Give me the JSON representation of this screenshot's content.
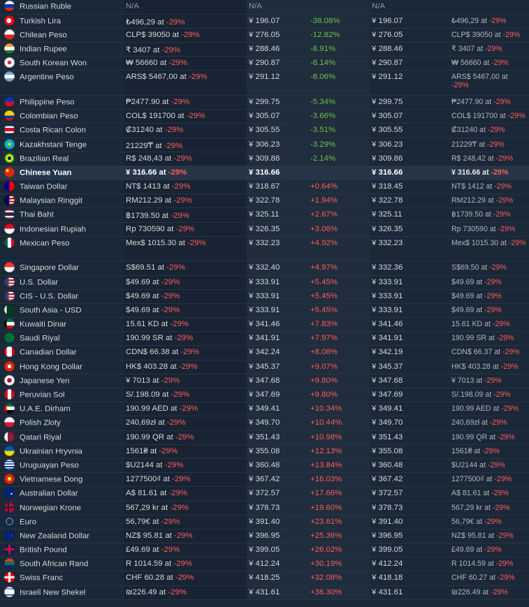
{
  "columns": [
    "country_currency",
    "local_price",
    "converted_price",
    "percent_diff",
    "converted_price_alt",
    "local_price_alt"
  ],
  "rows": [
    {
      "name": "Russian Ruble",
      "flag": "russia-flag",
      "local": "N/A",
      "conv": "N/A",
      "pct": "",
      "conv2": "N/A",
      "orig": ""
    },
    {
      "name": "Turkish Lira",
      "flag": "turkey-flag",
      "local": "₺496,29 at ",
      "disc": "-29%",
      "conv": "¥ 196.07",
      "pct": "-38.08%",
      "conv2": "¥ 196.07",
      "orig": "₺496,29 at ",
      "odisc": "-29%"
    },
    {
      "name": "Chilean Peso",
      "flag": "chile-flag",
      "local": "CLP$ 39050 at ",
      "disc": "-29%",
      "conv": "¥ 276.05",
      "pct": "-12.82%",
      "conv2": "¥ 276.05",
      "orig": "CLP$ 39050 at ",
      "odisc": "-29%"
    },
    {
      "name": "Indian Rupee",
      "flag": "india-flag",
      "local": "₹ 3407 at ",
      "disc": "-29%",
      "conv": "¥ 288.46",
      "pct": "-8.91%",
      "conv2": "¥ 288.46",
      "orig": "₹ 3407 at ",
      "odisc": "-29%"
    },
    {
      "name": "South Korean Won",
      "flag": "korea-flag",
      "local": "₩ 56660 at ",
      "disc": "-29%",
      "conv": "¥ 290.87",
      "pct": "-8.14%",
      "conv2": "¥ 290.87",
      "orig": "₩ 56660 at ",
      "odisc": "-29%"
    },
    {
      "name": "Argentine Peso",
      "flag": "argentina-flag",
      "local": "ARS$ 5467,00 at ",
      "disc": "-29%",
      "conv": "¥ 291.12",
      "pct": "-8.06%",
      "conv2": "¥ 291.12",
      "orig": "ARS$ 5467,00 at ",
      "odisc": "-29%",
      "tall": true
    },
    {
      "name": "Philippine Peso",
      "flag": "philippines-flag",
      "local": "₱2477.90 at ",
      "disc": "-29%",
      "conv": "¥ 299.75",
      "pct": "-5.34%",
      "conv2": "¥ 299.75",
      "orig": "₱2477.90 at ",
      "odisc": "-29%"
    },
    {
      "name": "Colombian Peso",
      "flag": "colombia-flag",
      "local": "COL$ 191700 at ",
      "disc": "-29%",
      "conv": "¥ 305.07",
      "pct": "-3.66%",
      "conv2": "¥ 305.07",
      "orig": "COL$ 191700 at ",
      "odisc": "-29%"
    },
    {
      "name": "Costa Rican Colon",
      "flag": "costa-rica-flag",
      "local": "₡31240 at ",
      "disc": "-29%",
      "conv": "¥ 305.55",
      "pct": "-3.51%",
      "conv2": "¥ 305.55",
      "orig": "₡31240 at ",
      "odisc": "-29%"
    },
    {
      "name": "Kazakhstani Tenge",
      "flag": "kazakhstan-flag",
      "local": "21229₸ at ",
      "disc": "-29%",
      "conv": "¥ 306.23",
      "pct": "-3.29%",
      "conv2": "¥ 306.23",
      "orig": "21229₸ at ",
      "odisc": "-29%"
    },
    {
      "name": "Brazilian Real",
      "flag": "brazil-flag",
      "local": "R$ 248,43 at ",
      "disc": "-29%",
      "conv": "¥ 309.88",
      "pct": "-2.14%",
      "conv2": "¥ 309.86",
      "orig": "R$ 248,42 at ",
      "odisc": "-29%"
    },
    {
      "name": "Chinese Yuan",
      "flag": "china-flag",
      "local": "¥ 316.66 at ",
      "disc": "-29%",
      "conv": "¥ 316.66",
      "pct": "",
      "conv2": "¥ 316.66",
      "orig": "¥ 316.66 at ",
      "odisc": "-29%",
      "highlight": true
    },
    {
      "name": "Taiwan Dollar",
      "flag": "taiwan-flag",
      "local": "NT$ 1413 at ",
      "disc": "-29%",
      "conv": "¥ 318.67",
      "pct": "+0.64%",
      "conv2": "¥ 318.45",
      "orig": "NT$ 1412 at ",
      "odisc": "-29%"
    },
    {
      "name": "Malaysian Ringgit",
      "flag": "malaysia-flag",
      "local": "RM212.29 at ",
      "disc": "-29%",
      "conv": "¥ 322.78",
      "pct": "+1.94%",
      "conv2": "¥ 322.78",
      "orig": "RM212.29 at ",
      "odisc": "-29%"
    },
    {
      "name": "Thai Baht",
      "flag": "thailand-flag",
      "local": "฿1739.50 at ",
      "disc": "-29%",
      "conv": "¥ 325.11",
      "pct": "+2.67%",
      "conv2": "¥ 325.11",
      "orig": "฿1739.50 at ",
      "odisc": "-29%"
    },
    {
      "name": "Indonesian Rupiah",
      "flag": "indonesia-flag",
      "local": "Rp 730590 at ",
      "disc": "-29%",
      "conv": "¥ 326.35",
      "pct": "+3.06%",
      "conv2": "¥ 326.35",
      "orig": "Rp 730590 at ",
      "odisc": "-29%"
    },
    {
      "name": "Mexican Peso",
      "flag": "mexico-flag",
      "local": "Mex$ 1015.30 at ",
      "disc": "-29%",
      "conv": "¥ 332.23",
      "pct": "+4.92%",
      "conv2": "¥ 332.23",
      "orig": "Mex$ 1015.30 at ",
      "odisc": "-29%",
      "tall": true
    },
    {
      "name": "Singapore Dollar",
      "flag": "singapore-flag",
      "local": "S$69.51 at ",
      "disc": "-29%",
      "conv": "¥ 332.40",
      "pct": "+4.97%",
      "conv2": "¥ 332.36",
      "orig": "S$69.50 at ",
      "odisc": "-29%"
    },
    {
      "name": "U.S. Dollar",
      "flag": "usa-flag",
      "local": "$49.69 at ",
      "disc": "-29%",
      "conv": "¥ 333.91",
      "pct": "+5.45%",
      "conv2": "¥ 333.91",
      "orig": "$49.69 at ",
      "odisc": "-29%"
    },
    {
      "name": "CIS - U.S. Dollar",
      "flag": "cis-flag",
      "local": "$49.69 at ",
      "disc": "-29%",
      "conv": "¥ 333.91",
      "pct": "+5.45%",
      "conv2": "¥ 333.91",
      "orig": "$49.69 at ",
      "odisc": "-29%"
    },
    {
      "name": "South Asia - USD",
      "flag": "pakistan-flag",
      "local": "$49.69 at ",
      "disc": "-29%",
      "conv": "¥ 333.91",
      "pct": "+5.45%",
      "conv2": "¥ 333.91",
      "orig": "$49.69 at ",
      "odisc": "-29%"
    },
    {
      "name": "Kuwaiti Dinar",
      "flag": "kuwait-flag",
      "local": "15.61 KD at ",
      "disc": "-29%",
      "conv": "¥ 341.46",
      "pct": "+7.83%",
      "conv2": "¥ 341.46",
      "orig": "15.61 KD at ",
      "odisc": "-29%"
    },
    {
      "name": "Saudi Riyal",
      "flag": "saudi-flag",
      "local": "190.99 SR at ",
      "disc": "-29%",
      "conv": "¥ 341.91",
      "pct": "+7.97%",
      "conv2": "¥ 341.91",
      "orig": "190.99 SR at ",
      "odisc": "-29%"
    },
    {
      "name": "Canadian Dollar",
      "flag": "canada-flag",
      "local": "CDN$ 66.38 at ",
      "disc": "-29%",
      "conv": "¥ 342.24",
      "pct": "+8.08%",
      "conv2": "¥ 342.19",
      "orig": "CDN$ 66.37 at ",
      "odisc": "-29%"
    },
    {
      "name": "Hong Kong Dollar",
      "flag": "hongkong-flag",
      "local": "HK$ 403.28 at ",
      "disc": "-29%",
      "conv": "¥ 345.37",
      "pct": "+9.07%",
      "conv2": "¥ 345.37",
      "orig": "HK$ 403.28 at ",
      "odisc": "-29%"
    },
    {
      "name": "Japanese Yen",
      "flag": "japan-flag",
      "local": "¥ 7013 at ",
      "disc": "-29%",
      "conv": "¥ 347.68",
      "pct": "+9.80%",
      "conv2": "¥ 347.68",
      "orig": "¥ 7013 at ",
      "odisc": "-29%"
    },
    {
      "name": "Peruvian Sol",
      "flag": "peru-flag",
      "local": "S/.198.09 at ",
      "disc": "-29%",
      "conv": "¥ 347.69",
      "pct": "+9.80%",
      "conv2": "¥ 347.69",
      "orig": "S/.198.09 at ",
      "odisc": "-29%"
    },
    {
      "name": "U.A.E. Dirham",
      "flag": "uae-flag",
      "local": "190.99 AED at ",
      "disc": "-29%",
      "conv": "¥ 349.41",
      "pct": "+10.34%",
      "conv2": "¥ 349.41",
      "orig": "190.99 AED at ",
      "odisc": "-29%"
    },
    {
      "name": "Polish Zloty",
      "flag": "poland-flag",
      "local": "240,69zł at ",
      "disc": "-29%",
      "conv": "¥ 349.70",
      "pct": "+10.44%",
      "conv2": "¥ 349.70",
      "orig": "240,69zł at ",
      "odisc": "-29%"
    },
    {
      "name": "Qatari Riyal",
      "flag": "qatar-flag",
      "local": "190.99 QR at ",
      "disc": "-29%",
      "conv": "¥ 351.43",
      "pct": "+10.98%",
      "conv2": "¥ 351.43",
      "orig": "190.99 QR at ",
      "odisc": "-29%"
    },
    {
      "name": "Ukrainian Hryvnia",
      "flag": "ukraine-flag",
      "local": "1561₴ at ",
      "disc": "-29%",
      "conv": "¥ 355.08",
      "pct": "+12.13%",
      "conv2": "¥ 355.08",
      "orig": "1561₴ at ",
      "odisc": "-29%"
    },
    {
      "name": "Uruguayan Peso",
      "flag": "uruguay-flag",
      "local": "$U2144 at ",
      "disc": "-29%",
      "conv": "¥ 360.48",
      "pct": "+13.84%",
      "conv2": "¥ 360.48",
      "orig": "$U2144 at ",
      "odisc": "-29%"
    },
    {
      "name": "Vietnamese Dong",
      "flag": "vietnam-flag",
      "local": "1277500₫ at ",
      "disc": "-29%",
      "conv": "¥ 367.42",
      "pct": "+16.03%",
      "conv2": "¥ 367.42",
      "orig": "1277500₫ at ",
      "odisc": "-29%"
    },
    {
      "name": "Australian Dollar",
      "flag": "australia-flag",
      "local": "A$ 81.61 at ",
      "disc": "-29%",
      "conv": "¥ 372.57",
      "pct": "+17.66%",
      "conv2": "¥ 372.57",
      "orig": "A$ 81.61 at ",
      "odisc": "-29%"
    },
    {
      "name": "Norwegian Krone",
      "flag": "norway-flag",
      "local": "567,29 kr at ",
      "disc": "-29%",
      "conv": "¥ 378.73",
      "pct": "+19.60%",
      "conv2": "¥ 378.73",
      "orig": "567,29 kr at ",
      "odisc": "-29%"
    },
    {
      "name": "Euro",
      "flag": "eu-flag",
      "local": "56,79€ at ",
      "disc": "-29%",
      "conv": "¥ 391.40",
      "pct": "+23.61%",
      "conv2": "¥ 391.40",
      "orig": "56,79€ at ",
      "odisc": "-29%"
    },
    {
      "name": "New Zealand Dollar",
      "flag": "newzealand-flag",
      "local": "NZ$ 95.81 at ",
      "disc": "-29%",
      "conv": "¥ 396.95",
      "pct": "+25.36%",
      "conv2": "¥ 396.95",
      "orig": "NZ$ 95.81 at ",
      "odisc": "-29%"
    },
    {
      "name": "British Pound",
      "flag": "uk-flag",
      "local": "£49.69 at ",
      "disc": "-29%",
      "conv": "¥ 399.05",
      "pct": "+26.02%",
      "conv2": "¥ 399.05",
      "orig": "£49.69 at ",
      "odisc": "-29%"
    },
    {
      "name": "South African Rand",
      "flag": "southafrica-flag",
      "local": "R 1014.59 at ",
      "disc": "-29%",
      "conv": "¥ 412.24",
      "pct": "+30.19%",
      "conv2": "¥ 412.24",
      "orig": "R 1014.59 at ",
      "odisc": "-29%"
    },
    {
      "name": "Swiss Franc",
      "flag": "switzerland-flag",
      "local": "CHF 60.28 at ",
      "disc": "-29%",
      "conv": "¥ 418.25",
      "pct": "+32.08%",
      "conv2": "¥ 418.18",
      "orig": "CHF 60.27 at ",
      "odisc": "-29%"
    },
    {
      "name": "Israeli New Shekel",
      "flag": "israel-flag",
      "local": "₪226.49 at ",
      "disc": "-29%",
      "conv": "¥ 431.61",
      "pct": "+36.30%",
      "conv2": "¥ 431.61",
      "orig": "₪226.49 at ",
      "odisc": "-29%"
    }
  ],
  "flag_colors": {
    "russia-flag": "#e8e8e8",
    "turkey-flag": "#e30a17",
    "chile-flag": "#d52b1e",
    "india-flag": "#ff9933",
    "korea-flag": "#f4f4f4",
    "argentina-flag": "#74acdf",
    "philippines-flag": "#0038a8",
    "colombia-flag": "#fcd116",
    "costa-rica-flag": "#ce1126",
    "kazakhstan-flag": "#00afca",
    "brazil-flag": "#009c3b",
    "china-flag": "#de2910",
    "taiwan-flag": "#fe0000",
    "malaysia-flag": "#010066",
    "thailand-flag": "#2d2a4a",
    "indonesia-flag": "#ce1126",
    "mexico-flag": "#006847",
    "singapore-flag": "#ef3340",
    "usa-flag": "#3c3b6e",
    "cis-flag": "#3c3b6e",
    "pakistan-flag": "#01411c",
    "kuwait-flag": "#007a3d",
    "saudi-flag": "#006c35",
    "canada-flag": "#ff0000",
    "hongkong-flag": "#de2910",
    "japan-flag": "#f4f4f4",
    "peru-flag": "#d91023",
    "uae-flag": "#00732f",
    "poland-flag": "#dc143c",
    "qatar-flag": "#8d1b3d",
    "ukraine-flag": "#0057b7",
    "uruguay-flag": "#0038a8",
    "vietnam-flag": "#da251d",
    "australia-flag": "#00247d",
    "norway-flag": "#ba0c2f",
    "eu-flag": "#003399",
    "newzealand-flag": "#00247d",
    "uk-flag": "#012169",
    "southafrica-flag": "#007a4d",
    "switzerland-flag": "#ff0000",
    "israel-flag": "#0038b8"
  }
}
